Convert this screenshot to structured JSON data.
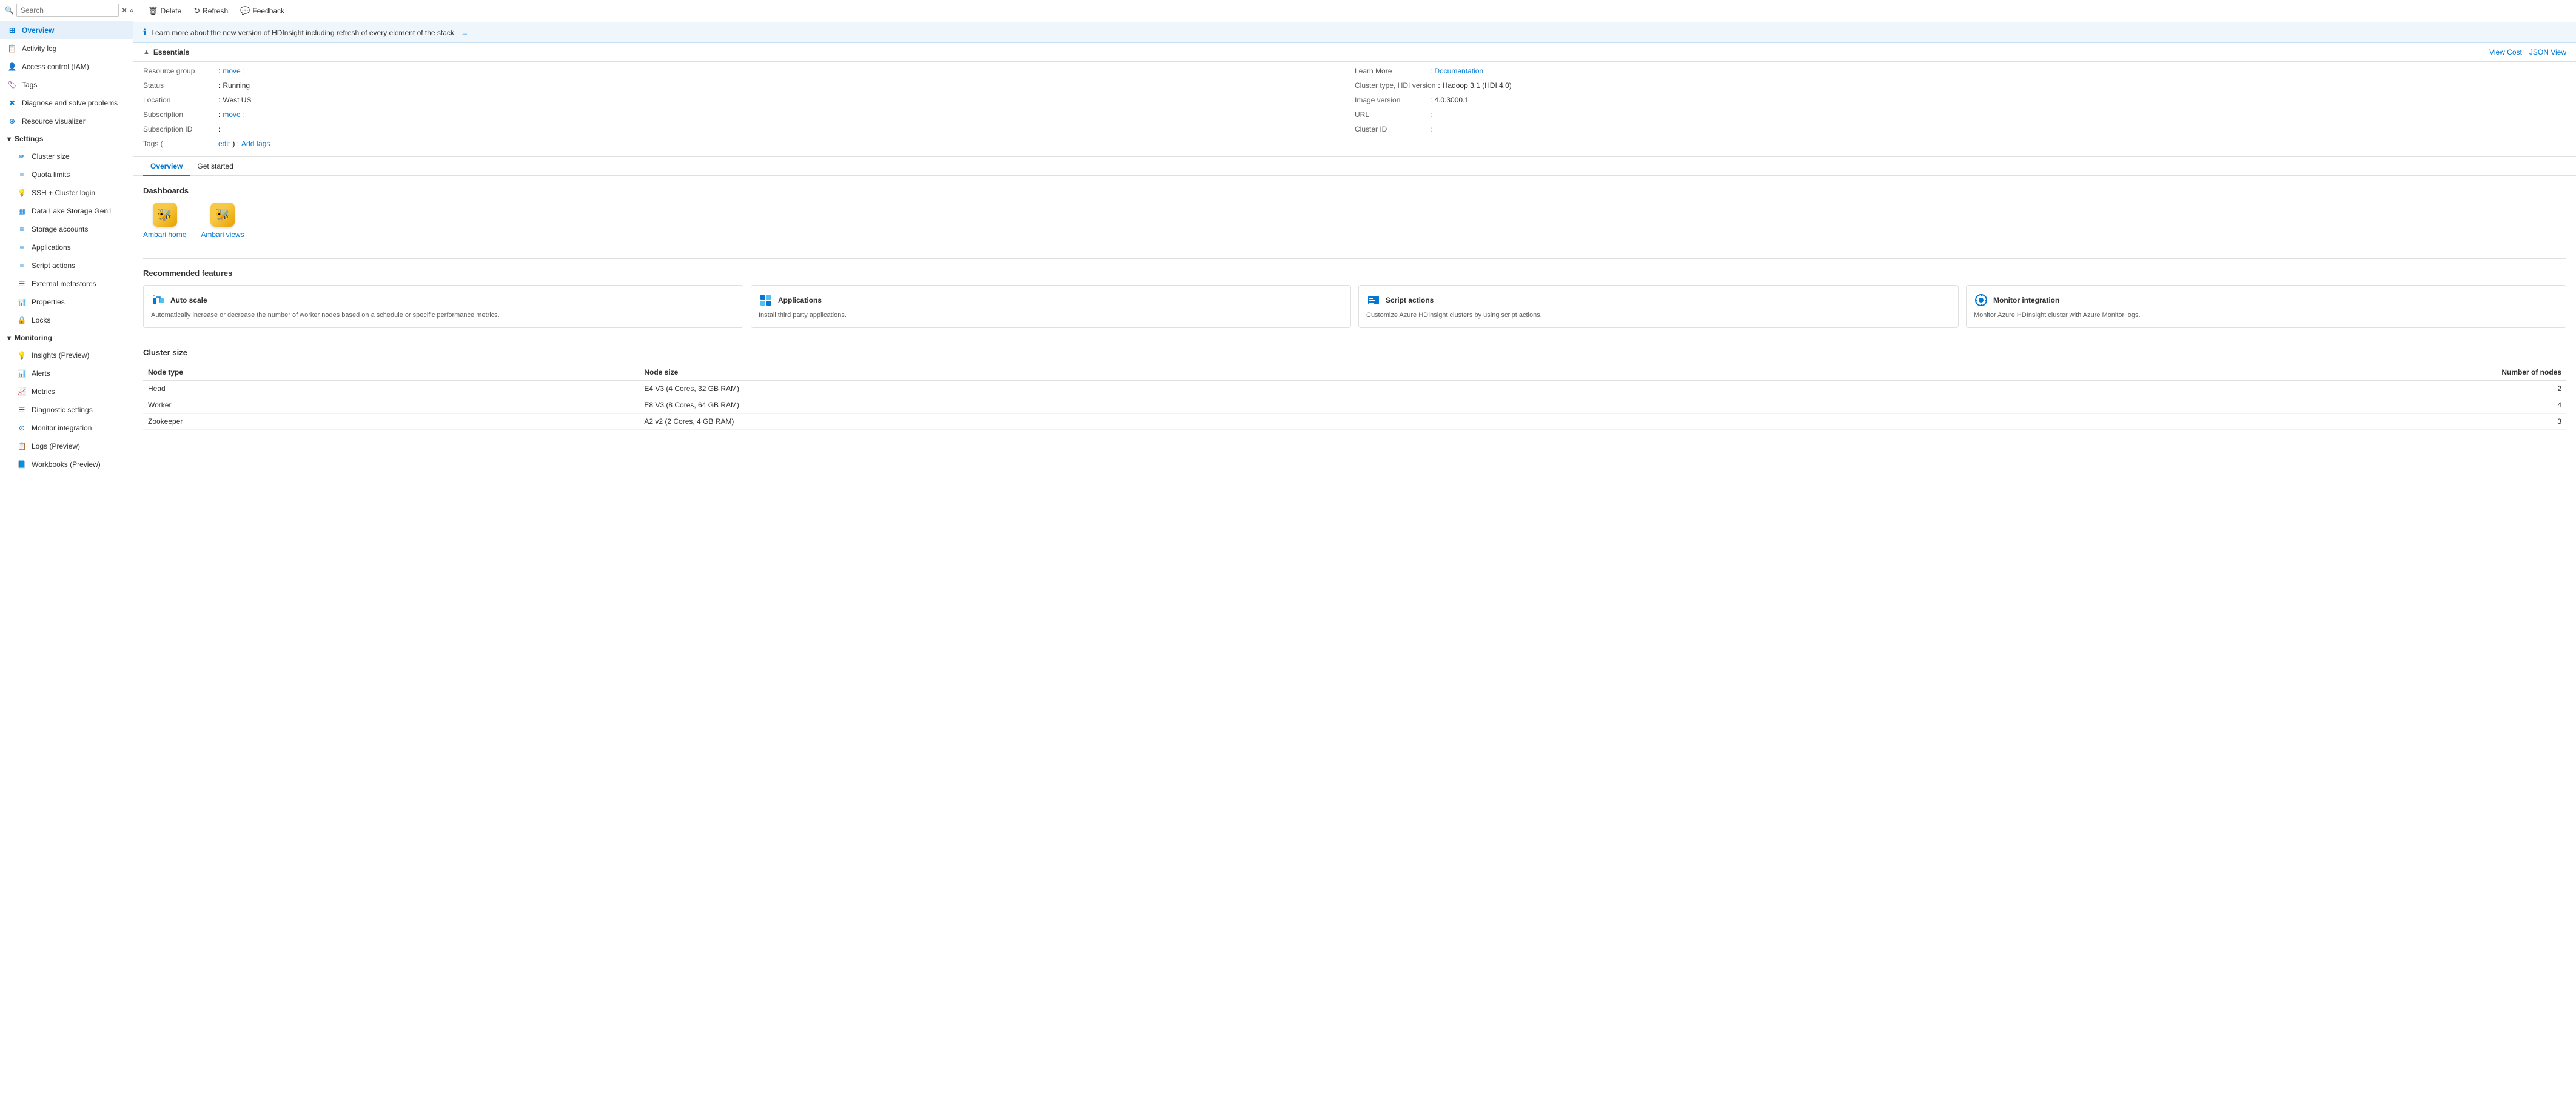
{
  "sidebar": {
    "search": {
      "placeholder": "Search",
      "value": ""
    },
    "items": [
      {
        "id": "overview",
        "label": "Overview",
        "icon": "⊞",
        "active": true,
        "indent": false
      },
      {
        "id": "activity-log",
        "label": "Activity log",
        "icon": "📋",
        "active": false,
        "indent": false
      },
      {
        "id": "access-control",
        "label": "Access control (IAM)",
        "icon": "👤",
        "active": false,
        "indent": false
      },
      {
        "id": "tags",
        "label": "Tags",
        "icon": "🏷",
        "active": false,
        "indent": false
      },
      {
        "id": "diagnose",
        "label": "Diagnose and solve problems",
        "icon": "🔧",
        "active": false,
        "indent": false
      },
      {
        "id": "resource-visualizer",
        "label": "Resource visualizer",
        "icon": "📊",
        "active": false,
        "indent": false
      }
    ],
    "sections": [
      {
        "id": "settings",
        "label": "Settings",
        "collapsed": false,
        "items": [
          {
            "id": "cluster-size",
            "label": "Cluster size",
            "icon": "✏"
          },
          {
            "id": "quota-limits",
            "label": "Quota limits",
            "icon": "☰"
          },
          {
            "id": "ssh-cluster-login",
            "label": "SSH + Cluster login",
            "icon": "💡"
          },
          {
            "id": "data-lake-storage",
            "label": "Data Lake Storage Gen1",
            "icon": "▦"
          },
          {
            "id": "storage-accounts",
            "label": "Storage accounts",
            "icon": "☰"
          },
          {
            "id": "applications",
            "label": "Applications",
            "icon": "☰"
          },
          {
            "id": "script-actions",
            "label": "Script actions",
            "icon": "☰"
          },
          {
            "id": "external-metastores",
            "label": "External metastores",
            "icon": "☰"
          },
          {
            "id": "properties",
            "label": "Properties",
            "icon": "📊"
          },
          {
            "id": "locks",
            "label": "Locks",
            "icon": "🔒"
          }
        ]
      },
      {
        "id": "monitoring",
        "label": "Monitoring",
        "collapsed": false,
        "items": [
          {
            "id": "insights-preview",
            "label": "Insights (Preview)",
            "icon": "💡"
          },
          {
            "id": "alerts",
            "label": "Alerts",
            "icon": "📊"
          },
          {
            "id": "metrics",
            "label": "Metrics",
            "icon": "📈"
          },
          {
            "id": "diagnostic-settings",
            "label": "Diagnostic settings",
            "icon": "☰"
          },
          {
            "id": "monitor-integration",
            "label": "Monitor integration",
            "icon": "⊙"
          },
          {
            "id": "logs-preview",
            "label": "Logs (Preview)",
            "icon": "📋"
          },
          {
            "id": "workbooks-preview",
            "label": "Workbooks (Preview)",
            "icon": "📘"
          }
        ]
      }
    ]
  },
  "toolbar": {
    "delete_label": "Delete",
    "refresh_label": "Refresh",
    "feedback_label": "Feedback"
  },
  "banner": {
    "text": "Learn more about the new version of HDInsight including refresh of every element of the stack.",
    "link_text": "→"
  },
  "essentials": {
    "title": "Essentials",
    "right_links": [
      {
        "label": "View Cost"
      },
      {
        "label": "JSON View"
      }
    ],
    "left": [
      {
        "label": "Resource group",
        "value": "",
        "link": "move"
      },
      {
        "label": "Status",
        "value": "Running"
      },
      {
        "label": "Location",
        "value": "West US"
      },
      {
        "label": "Subscription",
        "value": "",
        "link": "move"
      },
      {
        "label": "Subscription ID",
        "value": ""
      },
      {
        "label": "Tags",
        "value": "",
        "link_label": "edit",
        "link2_label": "Add tags"
      }
    ],
    "right": [
      {
        "label": "Learn More",
        "value": "",
        "link_label": "Documentation"
      },
      {
        "label": "Cluster type, HDI version",
        "value": "Hadoop 3.1 (HDI 4.0)"
      },
      {
        "label": "Image version",
        "value": "4.0.3000.1"
      },
      {
        "label": "URL",
        "value": ""
      },
      {
        "label": "Cluster ID",
        "value": ""
      }
    ]
  },
  "tabs": [
    {
      "id": "overview-tab",
      "label": "Overview",
      "active": true
    },
    {
      "id": "get-started-tab",
      "label": "Get started",
      "active": false
    }
  ],
  "dashboards": {
    "title": "Dashboards",
    "items": [
      {
        "id": "ambari-home",
        "label": "Ambari home"
      },
      {
        "id": "ambari-views",
        "label": "Ambari views"
      }
    ]
  },
  "recommended_features": {
    "title": "Recommended features",
    "items": [
      {
        "id": "auto-scale",
        "title": "Auto scale",
        "description": "Automatically increase or decrease the number of worker nodes based on a schedule or specific performance metrics."
      },
      {
        "id": "applications",
        "title": "Applications",
        "description": "Install third party applications."
      },
      {
        "id": "script-actions",
        "title": "Script actions",
        "description": "Customize Azure HDInsight clusters by using script actions."
      },
      {
        "id": "monitor-integration",
        "title": "Monitor integration",
        "description": "Monitor Azure HDInsight cluster with Azure Monitor logs."
      }
    ]
  },
  "cluster_size": {
    "title": "Cluster size",
    "headers": [
      "Node type",
      "Node size",
      "Number of nodes"
    ],
    "rows": [
      {
        "node_type": "Head",
        "node_size": "E4 V3 (4 Cores, 32 GB RAM)",
        "count": "2"
      },
      {
        "node_type": "Worker",
        "node_size": "E8 V3 (8 Cores, 64 GB RAM)",
        "count": "4"
      },
      {
        "node_type": "Zookeeper",
        "node_size": "A2 v2 (2 Cores, 4 GB RAM)",
        "count": "3"
      }
    ]
  }
}
